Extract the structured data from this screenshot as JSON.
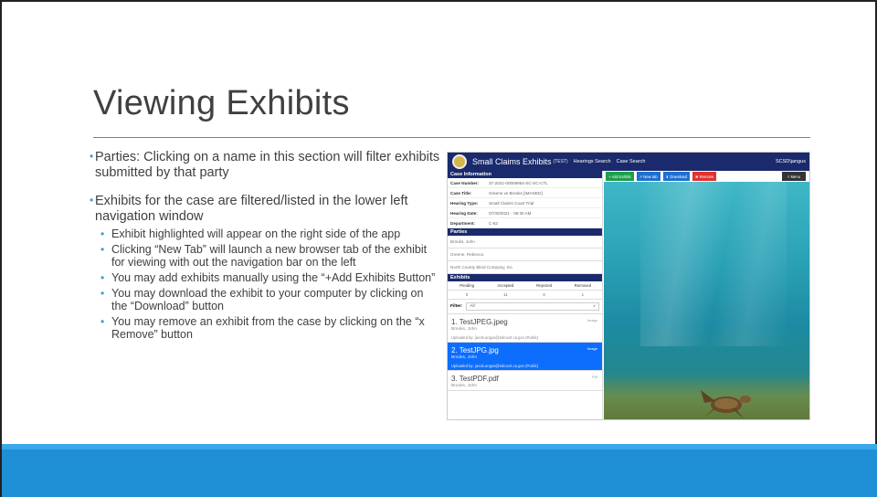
{
  "slide": {
    "title": "Viewing Exhibits",
    "bullets": [
      {
        "text": "Parties: Clicking on a name in this section will filter exhibits submitted by that party",
        "sub": []
      },
      {
        "text": "Exhibits for the case are filtered/listed in the lower left navigation window",
        "sub": [
          "Exhibit highlighted will appear on the right side of the app",
          "Clicking “New Tab” will launch a new browser tab of the exhibit for viewing with out the navigation bar on the left",
          "You may add exhibits manually using the “+Add Exhibits Button”",
          "You may download the exhibit to your computer by clicking on the “Download” button",
          "You may remove an exhibit from the case by clicking on the “x Remove” button"
        ]
      }
    ]
  },
  "colors": {
    "accent": "#2e9fd8",
    "footer": "#1f8fd6",
    "nav": "#1a2a6c",
    "active": "#0d6efd"
  },
  "app": {
    "brand": "Small Claims Exhibits",
    "env": "(TEST)",
    "nav_links": [
      "Hearings Search",
      "Case Search"
    ],
    "user": "SCSD\\jangus",
    "case_info": {
      "heading": "Case Information",
      "rows": [
        {
          "key": "Case Number:",
          "value": "37-2021-00008954-SC-SC-CTL"
        },
        {
          "key": "Case Title:",
          "value": "Greene vs Brooks [IMAGED]"
        },
        {
          "key": "Hearing Type:",
          "value": "Small Claims Court Trial"
        },
        {
          "key": "Hearing Date:",
          "value": "07/30/2021 - 08:30 AM"
        },
        {
          "key": "Department:",
          "value": "C-62"
        }
      ]
    },
    "parties": {
      "heading": "Parties",
      "items": [
        "Brooks, John",
        "Greene, Rebecca",
        "North County Blind Company, Inc."
      ]
    },
    "exhibits": {
      "heading": "Exhibits",
      "stats_labels": [
        "Pending",
        "Accepted",
        "Rejected",
        "Removed"
      ],
      "stats_values": [
        "0",
        "11",
        "0",
        "1"
      ],
      "filter_label": "Filter:",
      "filter_value": "All",
      "items": [
        {
          "name": "1. TestJPEG.jpeg",
          "party": "Brooks, John",
          "by": "Uploaded by: jacob.angus@sdcourt.ca.gov (Public)",
          "type": "Image",
          "active": false
        },
        {
          "name": "2. TestJPG.jpg",
          "party": "Brooks, John",
          "by": "Uploaded by: jacob.angus@sdcourt.ca.gov (Public)",
          "type": "Image",
          "active": true
        },
        {
          "name": "3. TestPDF.pdf",
          "party": "Brooks, John",
          "by": "",
          "type": "Pdf",
          "active": false
        }
      ]
    },
    "toolbar": {
      "add": "+ Add Exhibit",
      "newtab": "New tab",
      "download": "Download",
      "remove": "Remove",
      "menu": "Menu"
    }
  }
}
